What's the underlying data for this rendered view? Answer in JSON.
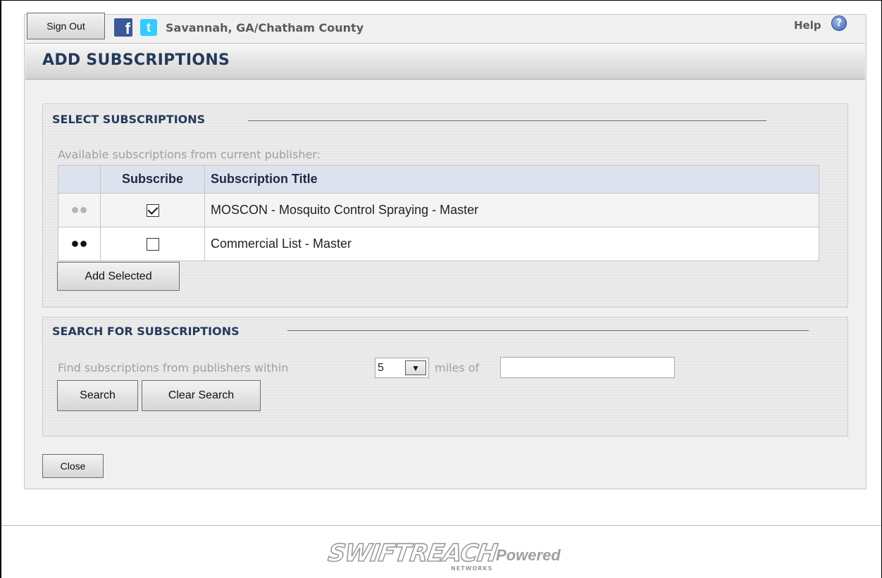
{
  "topbar": {
    "sign_out_label": "Sign Out",
    "location": "Savannah, GA/Chatham County",
    "help_label": "Help",
    "facebook_icon": "f",
    "twitter_icon": "t",
    "help_icon_glyph": "?"
  },
  "dialog": {
    "title": "ADD SUBSCRIPTIONS"
  },
  "select_section": {
    "legend": "SELECT SUBSCRIPTIONS",
    "available_label": "Available subscriptions from current publisher:",
    "columns": [
      "",
      "Subscribe",
      "Subscription Title"
    ],
    "rows": [
      {
        "icon": "group-icon-gray",
        "subscribed": true,
        "title": "MOSCON - Mosquito Control Spraying - Master"
      },
      {
        "icon": "group-icon-black",
        "subscribed": false,
        "title": "Commercial List - Master"
      }
    ],
    "add_selected_label": "Add Selected"
  },
  "search_section": {
    "legend": "SEARCH FOR SUBSCRIPTIONS",
    "find_prefix": "Find subscriptions from publishers within",
    "radius_value": "5",
    "miles_label": "miles of",
    "location_value": "",
    "search_label": "Search",
    "clear_label": "Clear Search"
  },
  "footer": {
    "close_label": "Close",
    "brand": "SWIFTREACH",
    "brand_sub": "NETWORKS",
    "powered": "Powered"
  },
  "colors": {
    "heading": "#233a5a",
    "facebook": "#3b5998",
    "twitter": "#33ccff",
    "table_header": "#dde3ee"
  }
}
